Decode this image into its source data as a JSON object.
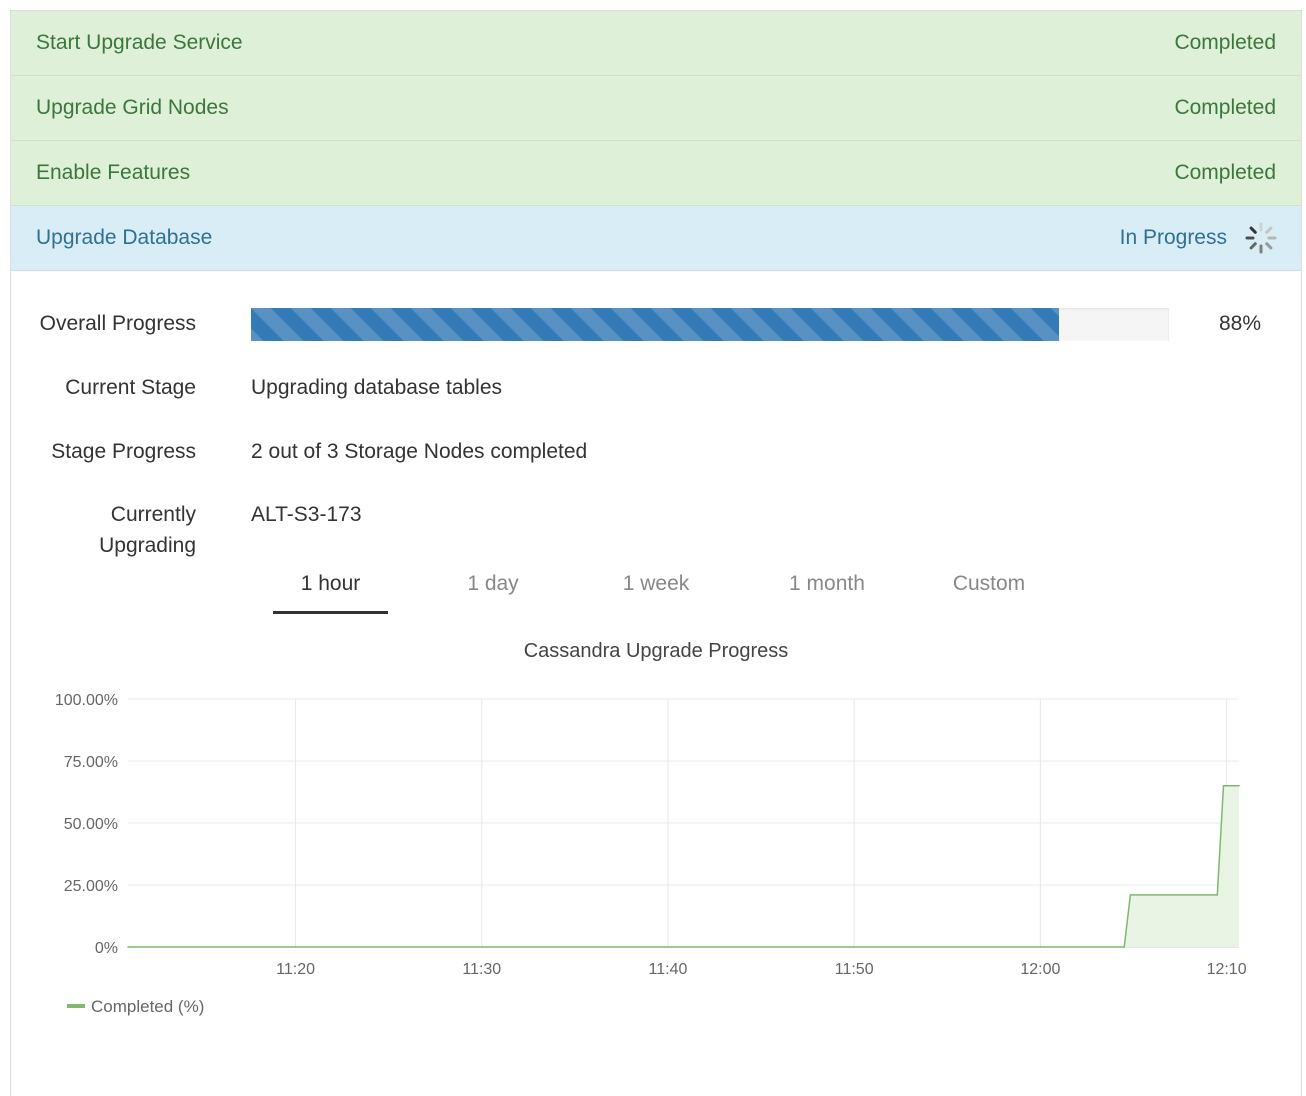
{
  "steps": [
    {
      "name": "Start Upgrade Service",
      "status": "Completed",
      "state": "completed"
    },
    {
      "name": "Upgrade Grid Nodes",
      "status": "Completed",
      "state": "completed"
    },
    {
      "name": "Enable Features",
      "status": "Completed",
      "state": "completed"
    },
    {
      "name": "Upgrade Database",
      "status": "In Progress",
      "state": "in-progress"
    }
  ],
  "details": {
    "overall_progress_label": "Overall Progress",
    "overall_progress_value": 88,
    "overall_progress_text": "88%",
    "current_stage_label": "Current Stage",
    "current_stage_value": "Upgrading database tables",
    "stage_progress_label": "Stage Progress",
    "stage_progress_value": "2 out of 3 Storage Nodes completed",
    "currently_upgrading_label_line1": "Currently",
    "currently_upgrading_label_line2": "Upgrading",
    "currently_upgrading_value": "ALT-S3-173"
  },
  "tabs": [
    {
      "label": "1 hour",
      "active": true
    },
    {
      "label": "1 day",
      "active": false
    },
    {
      "label": "1 week",
      "active": false
    },
    {
      "label": "1 month",
      "active": false
    },
    {
      "label": "Custom",
      "active": false
    }
  ],
  "colors": {
    "completed_bg": "#dff0d8",
    "completed_text": "#3c763d",
    "in_progress_bg": "#d9edf7",
    "in_progress_text": "#31708f",
    "progress_bar": "#337ab7",
    "chart_line": "#7fb96e"
  },
  "chart_data": {
    "type": "area",
    "title": "Cassandra Upgrade Progress",
    "xlabel": "",
    "ylabel": "",
    "x_ticks": [
      "11:20",
      "11:30",
      "11:40",
      "11:50",
      "12:00",
      "12:10"
    ],
    "y_ticks": [
      "0%",
      "25.00%",
      "50.00%",
      "75.00%",
      "100.00%"
    ],
    "ylim": [
      0,
      100
    ],
    "xlim": [
      "11:11",
      "12:10:40"
    ],
    "grid": true,
    "legend_position": "bottom-left",
    "series": [
      {
        "name": "Completed (%)",
        "points": [
          [
            "11:11",
            0
          ],
          [
            "12:04:30",
            0
          ],
          [
            "12:04:50",
            21
          ],
          [
            "12:09:30",
            21
          ],
          [
            "12:09:50",
            65
          ],
          [
            "12:10:40",
            65
          ]
        ]
      }
    ]
  }
}
